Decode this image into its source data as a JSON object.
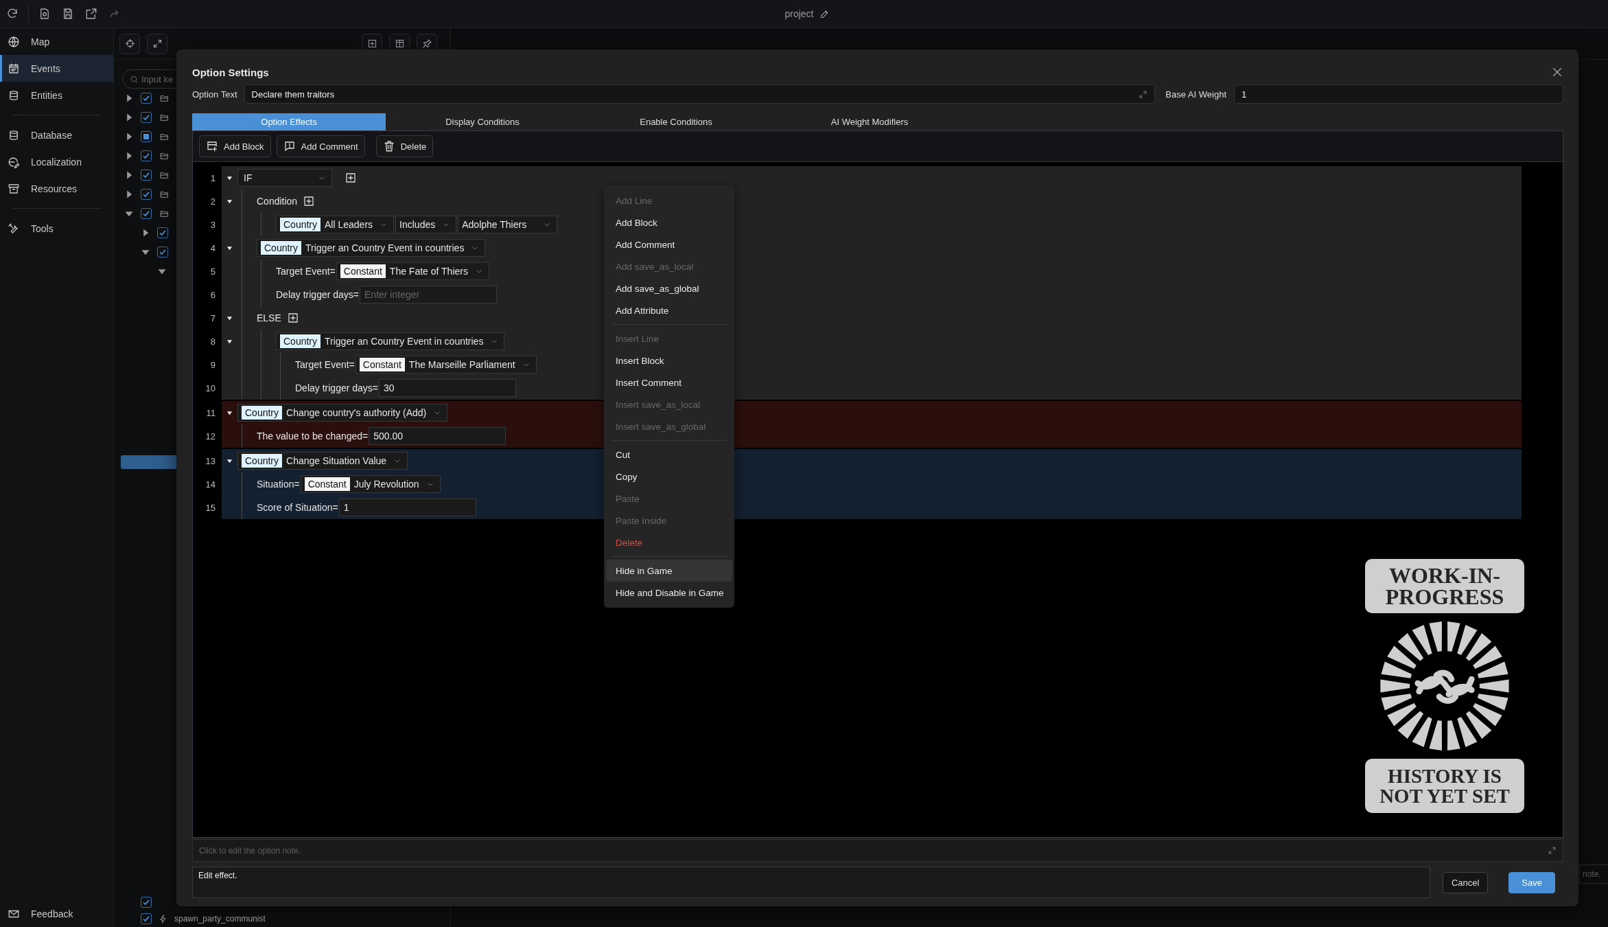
{
  "top_bar": {
    "title": "project"
  },
  "sidebar": {
    "sections": [
      [
        {
          "label": "Map",
          "selected": false
        },
        {
          "label": "Events",
          "selected": true
        },
        {
          "label": "Entities",
          "selected": false
        }
      ],
      [
        {
          "label": "Database",
          "selected": false
        },
        {
          "label": "Localization",
          "selected": false
        },
        {
          "label": "Resources",
          "selected": false
        }
      ],
      [
        {
          "label": "Tools",
          "selected": false
        }
      ]
    ],
    "footer": {
      "label": "Feedback"
    }
  },
  "list_panel": {
    "search": {
      "placeholder": "Input ke"
    },
    "rows": [
      {
        "expanded": false,
        "checked": true
      },
      {
        "expanded": false,
        "checked": true
      },
      {
        "expanded": false,
        "checked": false,
        "partial": true
      },
      {
        "expanded": false,
        "checked": true
      },
      {
        "expanded": false,
        "checked": true
      },
      {
        "expanded": false,
        "checked": true
      },
      {
        "expanded": true,
        "checked": true,
        "children": [
          {
            "expanded": false,
            "checked": true
          },
          {
            "expanded": true,
            "checked": true,
            "children": [
              {
                "expanded": true
              }
            ]
          }
        ]
      }
    ],
    "bottom_rows": [
      {
        "checked": true
      },
      {
        "checked": true,
        "label": "spawn_party_communist"
      }
    ]
  },
  "side_note": {
    "placeholder": "note."
  },
  "dialog": {
    "title": "Option Settings",
    "option_text": {
      "label": "Option Text",
      "value": "Declare them traitors"
    },
    "base_weight": {
      "label": "Base AI Weight",
      "value": "1"
    },
    "tabs": [
      {
        "label": "Option Effects",
        "selected": true
      },
      {
        "label": "Display Conditions",
        "selected": false
      },
      {
        "label": "Enable Conditions",
        "selected": false
      },
      {
        "label": "AI Weight Modifiers",
        "selected": false
      }
    ],
    "toolbar": [
      "Add Block",
      "Add Comment",
      "Delete"
    ],
    "code": {
      "blocks": [
        {
          "color": "#232323",
          "number": "1",
          "expanded": true,
          "kind": "keyword",
          "value": "IF",
          "children": [
            {
              "number": "2",
              "expanded": true,
              "kind": "group",
              "label": "Condition",
              "children": [
                {
                  "number": "3",
                  "kind": "condition",
                  "tag": {
                    "text": "Country",
                    "color": "#dff3ff"
                  },
                  "selects": [
                    "All Leaders",
                    "Includes",
                    "Adolphe Thiers"
                  ]
                }
              ]
            },
            {
              "number": "4",
              "expanded": true,
              "kind": "effect",
              "tag": {
                "text": "Country",
                "color": "#dff3ff"
              },
              "value": "Trigger an Country Event in countries",
              "children": [
                {
                  "number": "5",
                  "kind": "param_select",
                  "label": "Target Event=",
                  "tag": {
                    "text": "Constant",
                    "color": "#f4f4f4"
                  },
                  "value": "The Fate of Thiers"
                },
                {
                  "number": "6",
                  "kind": "param_input",
                  "label": "Delay trigger days=",
                  "placeholder": "Enter integer"
                }
              ]
            },
            {
              "number": "7",
              "expanded": true,
              "kind": "group",
              "label": "ELSE",
              "children": [
                {
                  "number": "8",
                  "expanded": true,
                  "kind": "effect",
                  "tag": {
                    "text": "Country",
                    "color": "#dff3ff"
                  },
                  "value": "Trigger an Country Event in countries",
                  "children": [
                    {
                      "number": "9",
                      "kind": "param_select",
                      "label": "Target Event=",
                      "tag": {
                        "text": "Constant",
                        "color": "#f4f4f4"
                      },
                      "value": "The Marseille Parliament"
                    },
                    {
                      "number": "10",
                      "kind": "param_input",
                      "label": "Delay trigger days=",
                      "value": "30"
                    }
                  ]
                }
              ]
            }
          ]
        },
        {
          "color": "#2b0f0c",
          "number": "11",
          "expanded": true,
          "kind": "effect",
          "tag": {
            "text": "Country",
            "color": "#dff3ff"
          },
          "value": "Change country's authority (Add)",
          "children": [
            {
              "number": "12",
              "kind": "param_input",
              "label": "The value to be changed=",
              "value": "500.00"
            }
          ]
        },
        {
          "color": "#13202f",
          "number": "13",
          "expanded": true,
          "kind": "effect",
          "tag": {
            "text": "Country",
            "color": "#dff3ff"
          },
          "value": "Change Situation Value",
          "children": [
            {
              "number": "14",
              "kind": "param_select",
              "label": "Situation=",
              "tag": {
                "text": "Constant",
                "color": "#f4f4f4"
              },
              "value": "July Revolution"
            },
            {
              "number": "15",
              "kind": "param_input",
              "label": "Score of Situation=",
              "value": "1"
            }
          ]
        }
      ]
    },
    "badge": {
      "top": "WORK-IN-PROGRESS",
      "bottom": "HISTORY IS NOT YET SET"
    },
    "note": {
      "placeholder": "Click to edit the option note."
    },
    "effect": {
      "value": "Edit effect."
    },
    "buttons": {
      "cancel": "Cancel",
      "save": "Save"
    }
  },
  "context_menu": {
    "sections": [
      [
        {
          "label": "Add Line",
          "disabled": true,
          "danger": false,
          "highlighted": false
        },
        {
          "label": "Add Block",
          "disabled": false,
          "danger": false,
          "highlighted": false
        },
        {
          "label": "Add Comment",
          "disabled": false,
          "danger": false,
          "highlighted": false
        },
        {
          "label": "Add save_as_local",
          "disabled": true,
          "danger": false,
          "highlighted": false
        },
        {
          "label": "Add save_as_global",
          "disabled": false,
          "danger": false,
          "highlighted": false
        },
        {
          "label": "Add Attribute",
          "disabled": false,
          "danger": false,
          "highlighted": false
        }
      ],
      [
        {
          "label": "Insert Line",
          "disabled": true,
          "danger": false,
          "highlighted": false
        },
        {
          "label": "Insert Block",
          "disabled": false,
          "danger": false,
          "highlighted": false
        },
        {
          "label": "Insert Comment",
          "disabled": false,
          "danger": false,
          "highlighted": false
        },
        {
          "label": "Insert save_as_local",
          "disabled": true,
          "danger": false,
          "highlighted": false
        },
        {
          "label": "Insert save_as_global",
          "disabled": true,
          "danger": false,
          "highlighted": false
        }
      ],
      [
        {
          "label": "Cut",
          "disabled": false,
          "danger": false,
          "highlighted": false
        },
        {
          "label": "Copy",
          "disabled": false,
          "danger": false,
          "highlighted": false
        },
        {
          "label": "Paste",
          "disabled": true,
          "danger": false,
          "highlighted": false
        },
        {
          "label": "Paste Inside",
          "disabled": true,
          "danger": false,
          "highlighted": false
        },
        {
          "label": "Delete",
          "disabled": false,
          "danger": true,
          "highlighted": false
        }
      ],
      [
        {
          "label": "Hide in Game",
          "disabled": false,
          "danger": false,
          "highlighted": true
        },
        {
          "label": "Hide and Disable in Game",
          "disabled": false,
          "danger": false,
          "highlighted": false
        }
      ]
    ]
  }
}
